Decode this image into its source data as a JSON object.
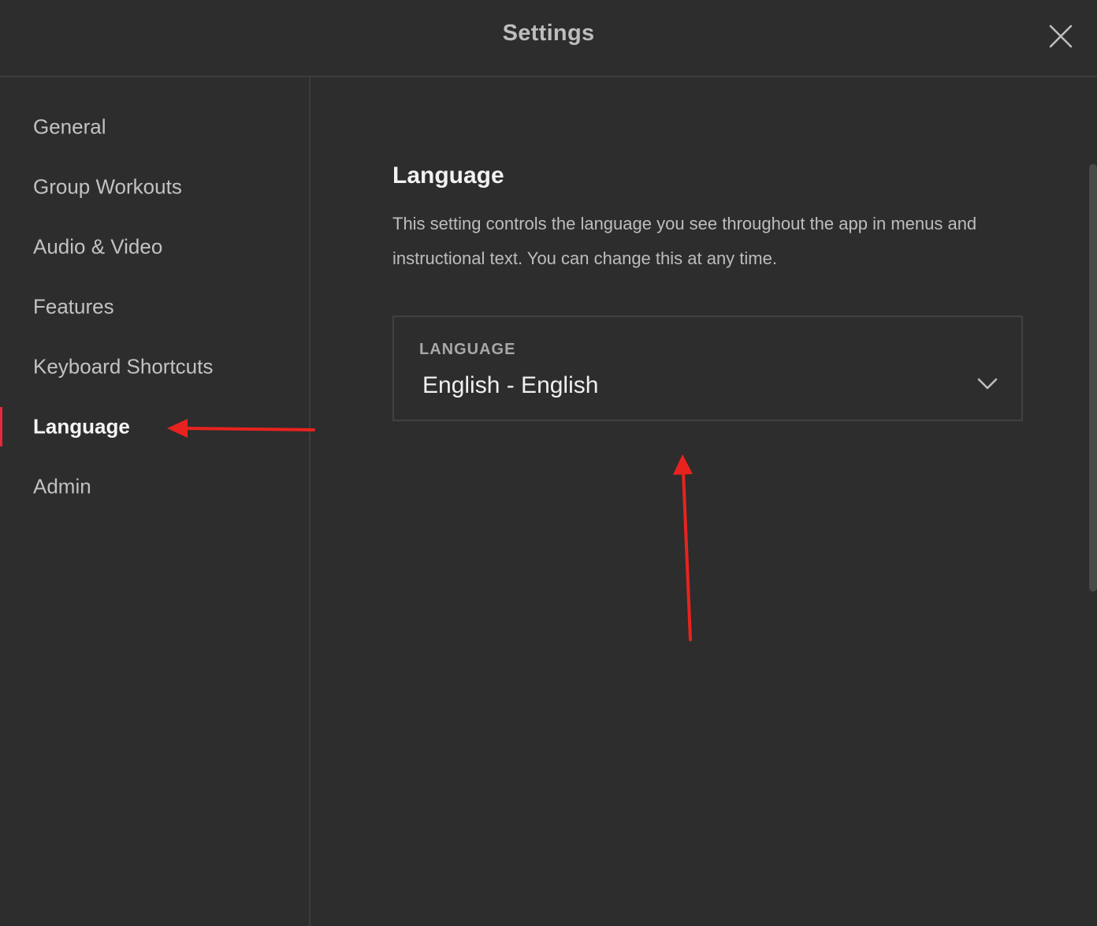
{
  "header": {
    "title": "Settings"
  },
  "sidebar": {
    "items": [
      {
        "label": "General"
      },
      {
        "label": "Group Workouts"
      },
      {
        "label": "Audio & Video"
      },
      {
        "label": "Features"
      },
      {
        "label": "Keyboard Shortcuts"
      },
      {
        "label": "Language",
        "active": true
      },
      {
        "label": "Admin"
      }
    ]
  },
  "main": {
    "title": "Language",
    "description": "This setting controls the language you see throughout the app in menus and instructional text. You can change this at any time.",
    "language_select": {
      "label": "LANGUAGE",
      "value": "English - English"
    }
  },
  "icons": {
    "close": "close-icon",
    "dropdown": "chevron-down-icon"
  },
  "colors": {
    "background": "#2d2d2d",
    "accent": "#e8293b",
    "annotation": "#e8231f"
  }
}
